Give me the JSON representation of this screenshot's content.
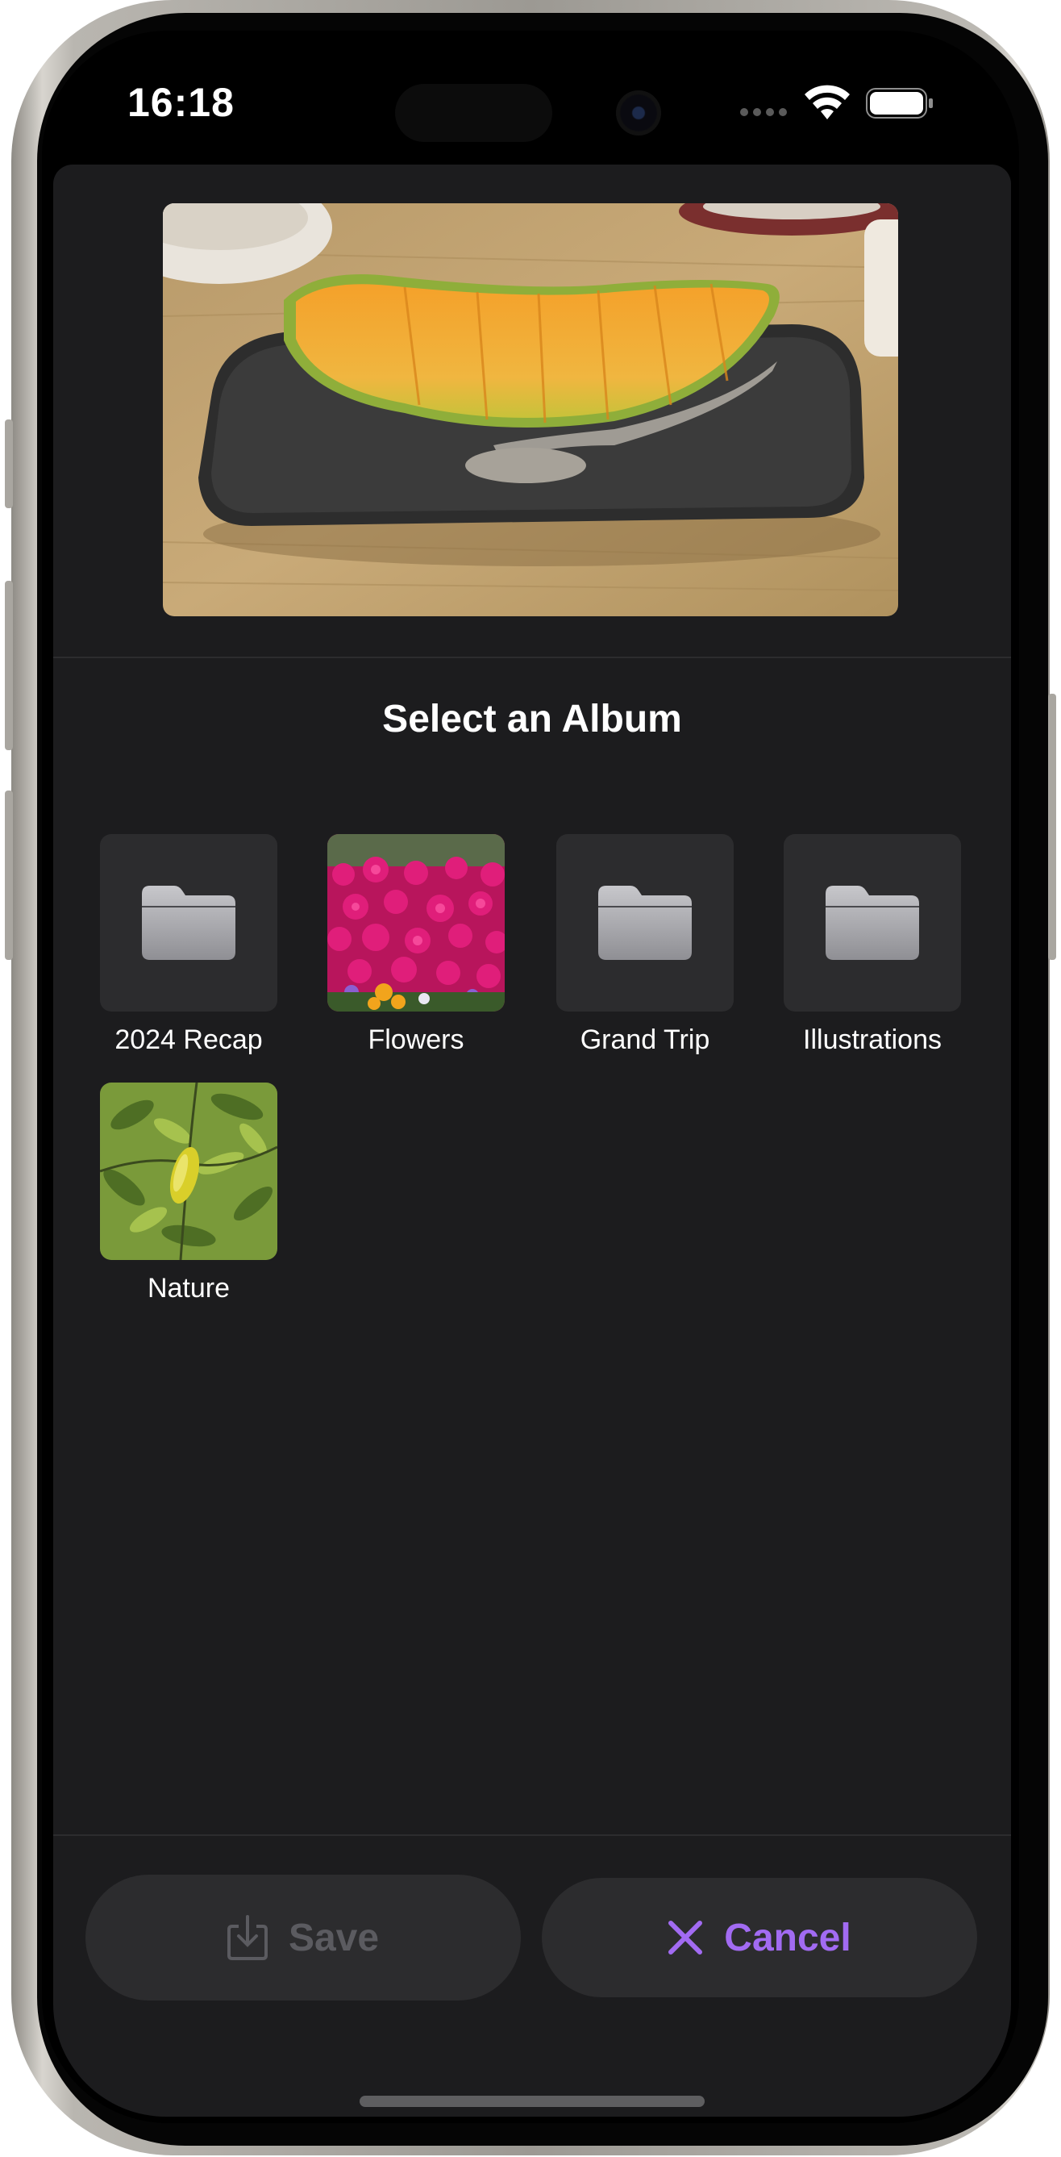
{
  "status_bar": {
    "time": "16:18",
    "icons": [
      "signal-icon",
      "wifi-icon",
      "battery-icon"
    ]
  },
  "preview": {
    "icon": "photo-preview-melon"
  },
  "picker": {
    "title": "Select an Album",
    "albums": [
      {
        "label": "2024 Recap",
        "thumb": "folder-icon"
      },
      {
        "label": "Flowers",
        "thumb": "flowers-photo"
      },
      {
        "label": "Grand Trip",
        "thumb": "folder-icon"
      },
      {
        "label": "Illustrations",
        "thumb": "folder-icon"
      },
      {
        "label": "Nature",
        "thumb": "leaves-photo"
      }
    ]
  },
  "actions": {
    "save_label": "Save",
    "save_icon": "download-tray-icon",
    "save_enabled": false,
    "cancel_label": "Cancel",
    "cancel_icon": "close-icon"
  },
  "colors": {
    "background": "#1c1c1e",
    "button": "#2c2c2e",
    "accent": "#a26bf2",
    "disabled": "#5b5b60"
  }
}
